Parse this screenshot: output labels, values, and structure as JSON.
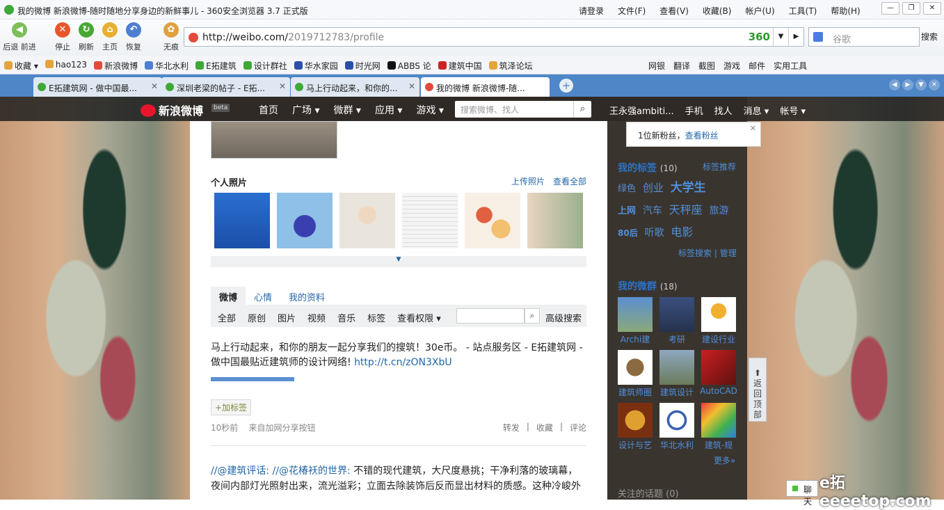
{
  "window": {
    "title": "我的微博 新浪微博-随时随地分享身边的新鲜事儿 - 360安全浏览器 3.7 正式版",
    "menu": [
      "请登录",
      "文件(F)",
      "查看(V)",
      "收藏(B)",
      "帐户(U)",
      "工具(T)",
      "帮助(H)"
    ]
  },
  "nav": {
    "buttons": [
      "后退 前进",
      "停止",
      "刷新",
      "主页",
      "恢复",
      "无痕"
    ],
    "url_host": "http://weibo.com/",
    "url_path": "2019712783/profile",
    "browser_logo": "360",
    "search_placeholder": "谷歌",
    "search_button": "搜索"
  },
  "favorites": {
    "items": [
      "收藏",
      "hao123",
      "新浪微博",
      "华北水利",
      "E拓建筑",
      "设计群社",
      "华水家园",
      "时光网",
      "ABBS 论",
      "建筑中国",
      "筑泽论坛"
    ],
    "tools": [
      "网银",
      "翻译",
      "截图",
      "游戏",
      "邮件",
      "实用工具"
    ]
  },
  "tabs": [
    {
      "label": "E拓建筑网 - 做中国最..."
    },
    {
      "label": "深圳老梁的帖子 - E拓..."
    },
    {
      "label": "马上行动起来，和你的..."
    },
    {
      "label": "我的微博 新浪微博-随..."
    }
  ],
  "weibo_nav": {
    "brand": "新浪微博",
    "beta": "beta",
    "items": [
      "首页",
      "广场 ▾",
      "微群 ▾",
      "应用 ▾",
      "游戏 ▾"
    ],
    "search_placeholder": "搜索微博、找人",
    "user": [
      "王永强ambiti...",
      "手机",
      "找人",
      "消息 ▾",
      "帐号 ▾"
    ]
  },
  "photos": {
    "title": "个人照片",
    "upload": "上传照片",
    "view_all": "查看全部",
    "thumb_colors": [
      "#2a6fd0",
      "#5b6fd6",
      "#e9e4dc",
      "#f4f4f4",
      "#e0b070",
      "#9bb08e"
    ]
  },
  "feed": {
    "tabs": [
      "微博",
      "心情",
      "我的资料"
    ],
    "filters": [
      "全部",
      "原创",
      "图片",
      "视频",
      "音乐",
      "标签",
      "查看权限 ▾"
    ],
    "advanced_search": "高级搜索",
    "post1_text": "马上行动起来，和你的朋友一起分享我们的搜筑！30e币。 - 站点服务区 - E拓建筑网 - 做中国最贴近建筑师的设计网络! ",
    "post1_link": "http://t.cn/zON3XbU",
    "add_tag": "+加标签",
    "time": "10秒前",
    "source": "来自加网分享按钮",
    "actions": [
      "转发",
      "收藏",
      "评论"
    ],
    "post2_prefix": "//@建筑评话: //@花椿袄的世界:",
    "post2_text": " 不错的现代建筑，大尺度悬挑；干净利落的玻璃幕，夜间内部灯光照射出来，流光溢彩；立面去除装饰后反而显出材料的质感。这种冷峻外"
  },
  "sidebar": {
    "notification": "1位新粉丝，",
    "notification_link": "查看粉丝",
    "tags_title": "我的标签",
    "tags_count": "(10)",
    "tags_recommend": "标签推荐",
    "tags": [
      "绿色",
      "创业",
      "大学生",
      "上网",
      "汽车",
      "天秤座",
      "旅游",
      "80后",
      "听歌",
      "电影"
    ],
    "tag_search": "标签搜索",
    "tag_manage": "管理",
    "groups_title": "我的微群",
    "groups_count": "(18)",
    "groups": [
      "Archi建",
      "考研",
      "建设行业",
      "建筑师圈",
      "建筑设计",
      "AutoCAD",
      "设计与艺",
      "华北水利",
      "建筑-规"
    ],
    "more": "更多»",
    "topics_title": "关注的话题 (0)"
  },
  "back_top": "返回顶部",
  "watermark": "e拓 eeeetop.com",
  "chat": "聊天"
}
